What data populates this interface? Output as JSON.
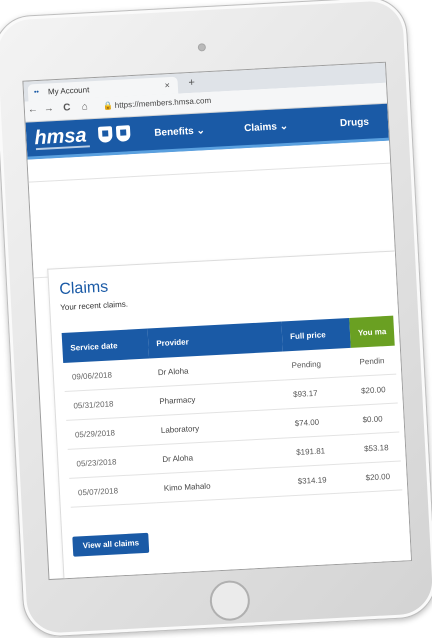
{
  "browser": {
    "tab_title": "My Account",
    "tab_favicon": "••",
    "tab_close": "×",
    "new_tab": "+",
    "url": "https://members.hmsa.com",
    "back": "←",
    "forward": "→",
    "reload": "C",
    "home": "⌂",
    "lock": "🔒"
  },
  "site": {
    "logo": "hmsa",
    "nav": [
      {
        "label": "Benefits ⌄"
      },
      {
        "label": "Claims ⌄"
      },
      {
        "label": "Drugs"
      }
    ],
    "brand_color": "#1a5aa6",
    "accent_color": "#6aa022"
  },
  "claims": {
    "title": "Claims",
    "subtitle": "Your recent claims.",
    "columns": [
      "Service date",
      "Provider",
      "Full price",
      "You ma"
    ],
    "rows": [
      {
        "date": "09/06/2018",
        "provider": "Dr Aloha",
        "full_price": "Pending",
        "you_pay": "Pendin"
      },
      {
        "date": "05/31/2018",
        "provider": "Pharmacy",
        "full_price": "$93.17",
        "you_pay": "$20.00"
      },
      {
        "date": "05/29/2018",
        "provider": "Laboratory",
        "full_price": "$74.00",
        "you_pay": "$0.00"
      },
      {
        "date": "05/23/2018",
        "provider": "Dr Aloha",
        "full_price": "$191.81",
        "you_pay": "$53.18"
      },
      {
        "date": "05/07/2018",
        "provider": "Kimo Mahalo",
        "full_price": "$314.19",
        "you_pay": "$20.00"
      }
    ],
    "view_all_label": "View all claims"
  }
}
